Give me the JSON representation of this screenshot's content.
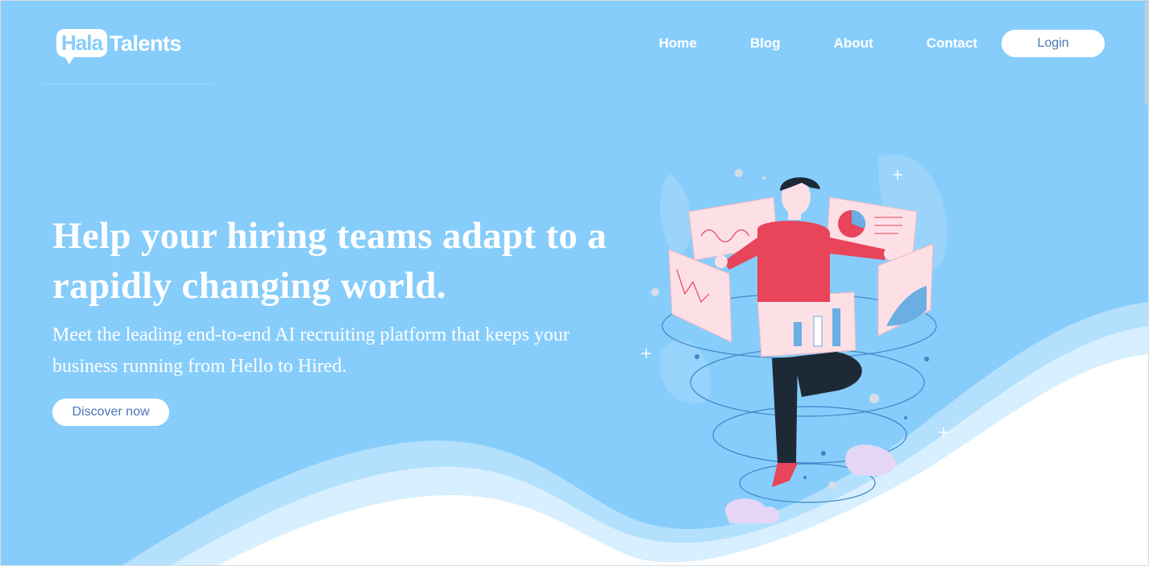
{
  "brand": {
    "logo_bubble": "Hala",
    "logo_word": "Talents"
  },
  "nav": {
    "items": [
      {
        "label": "Home"
      },
      {
        "label": "Blog"
      },
      {
        "label": "About"
      },
      {
        "label": "Contact"
      }
    ],
    "login_label": "Login"
  },
  "hero": {
    "headline": "Help your hiring teams adapt to a rapidly changing world.",
    "subtext": "Meet the leading end-to-end AI recruiting platform that keeps your business running from Hello to Hired.",
    "cta_label": "Discover now"
  },
  "colors": {
    "background": "#87cdfb",
    "wave_light": "#b3e0fd",
    "wave_lighter": "#d7effe",
    "wave_white": "#ffffff",
    "button_text": "#4b74b8",
    "shirt": "#e8445a",
    "panel": "#fde0e6"
  },
  "icons": [
    "speech-bubble-logo-icon",
    "hiring-analytics-illustration"
  ]
}
